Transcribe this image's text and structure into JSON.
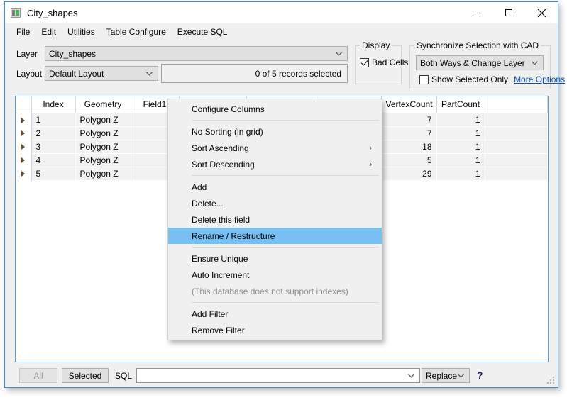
{
  "window": {
    "title": "City_shapes",
    "icon": "app-icon",
    "minimize_label": "Minimize",
    "maximize_label": "Maximize",
    "close_label": "Close"
  },
  "menubar": {
    "items": [
      {
        "label": "File"
      },
      {
        "label": "Edit"
      },
      {
        "label": "Utilities"
      },
      {
        "label": "Table Configure"
      },
      {
        "label": "Execute SQL"
      }
    ]
  },
  "toolbar": {
    "layer_label": "Layer",
    "layer_value": "City_shapes",
    "layout_label": "Layout",
    "layout_value": "Default Layout",
    "records_status": "0 of 5 records selected",
    "display_group_title": "Display",
    "bad_cells_label": "Bad Cells",
    "bad_cells_checked": true,
    "sync_group_title": "Synchronize Selection with CAD",
    "sync_value": "Both Ways & Change Layer",
    "show_selected_only_label": "Show Selected Only",
    "show_selected_only_checked": false,
    "more_options_label": "More Options"
  },
  "grid": {
    "columns": [
      {
        "label": "",
        "key": "rowhdr"
      },
      {
        "label": "Index",
        "key": "index"
      },
      {
        "label": "Geometry",
        "key": "geometry"
      },
      {
        "label": "Field1",
        "key": "field1"
      },
      {
        "label": "",
        "key": "hidden1"
      },
      {
        "label": "",
        "key": "hidden2"
      },
      {
        "label": "",
        "key": "hidden3"
      },
      {
        "label": "VertexCount",
        "key": "vertexcount"
      },
      {
        "label": "PartCount",
        "key": "partcount"
      },
      {
        "label": "",
        "key": "pad"
      }
    ],
    "rows": [
      {
        "index": "1",
        "geometry": "Polygon Z",
        "field1": "",
        "vertexcount": "7",
        "partcount": "1"
      },
      {
        "index": "2",
        "geometry": "Polygon Z",
        "field1": "",
        "vertexcount": "7",
        "partcount": "1"
      },
      {
        "index": "3",
        "geometry": "Polygon Z",
        "field1": "",
        "vertexcount": "18",
        "partcount": "1"
      },
      {
        "index": "4",
        "geometry": "Polygon Z",
        "field1": "",
        "vertexcount": "5",
        "partcount": "1"
      },
      {
        "index": "5",
        "geometry": "Polygon Z",
        "field1": "",
        "vertexcount": "29",
        "partcount": "1"
      }
    ],
    "selected_cell_color": "#6cb2f0"
  },
  "context_menu": {
    "items": [
      {
        "label": "Configure Columns",
        "type": "item"
      },
      {
        "type": "separator"
      },
      {
        "label": "No Sorting (in grid)",
        "type": "item"
      },
      {
        "label": "Sort Ascending",
        "type": "submenu",
        "arrow": "›"
      },
      {
        "label": "Sort Descending",
        "type": "submenu",
        "arrow": "›"
      },
      {
        "type": "separator"
      },
      {
        "label": "Add",
        "type": "item"
      },
      {
        "label": "Delete...",
        "type": "item"
      },
      {
        "label": "Delete this field",
        "type": "item"
      },
      {
        "label": "Rename / Restructure",
        "type": "item",
        "state": "highlighted"
      },
      {
        "type": "separator"
      },
      {
        "label": "Ensure Unique",
        "type": "item"
      },
      {
        "label": "Auto Increment",
        "type": "item"
      },
      {
        "label": "(This database does not support indexes)",
        "type": "item",
        "state": "disabled"
      },
      {
        "type": "separator"
      },
      {
        "label": "Add Filter",
        "type": "item"
      },
      {
        "label": "Remove Filter",
        "type": "item"
      }
    ],
    "highlight_color": "#79c0f2"
  },
  "bottombar": {
    "all_label": "All",
    "all_disabled": true,
    "selected_label": "Selected",
    "sql_label": "SQL",
    "sql_value": "",
    "replace_value": "Replace",
    "help_label": "?"
  }
}
